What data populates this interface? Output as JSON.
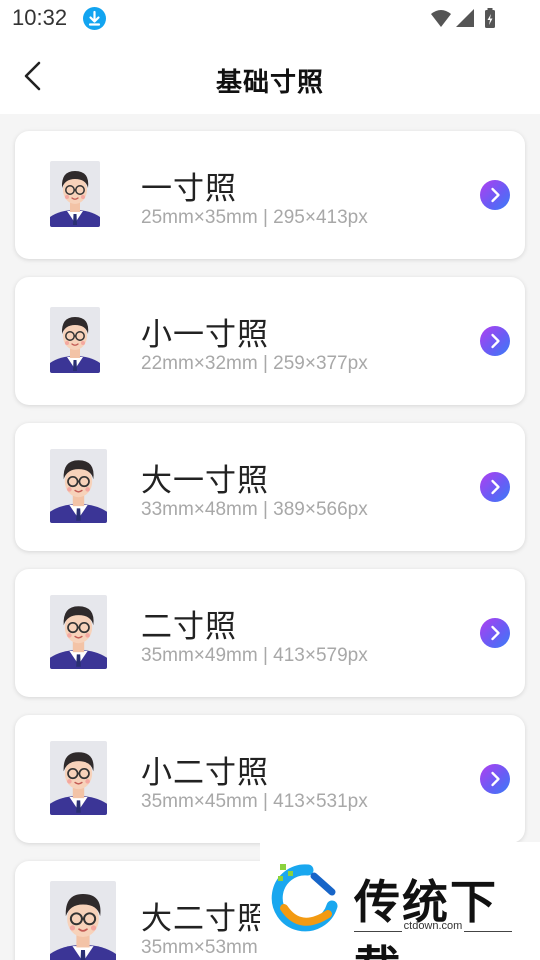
{
  "status_bar": {
    "time": "10:32"
  },
  "header": {
    "title": "基础寸照"
  },
  "items": [
    {
      "name": "一寸照",
      "spec": "25mm×35mm | 295×413px"
    },
    {
      "name": "小一寸照",
      "spec": "22mm×32mm | 259×377px"
    },
    {
      "name": "大一寸照",
      "spec": "33mm×48mm | 389×566px"
    },
    {
      "name": "二寸照",
      "spec": "35mm×49mm | 413×579px"
    },
    {
      "name": "小二寸照",
      "spec": "35mm×45mm | 413×531px"
    },
    {
      "name": "大二寸照",
      "spec": "35mm×53mm"
    }
  ],
  "watermark": {
    "text": "传统下载",
    "url": "ctdown.com"
  },
  "colors": {
    "accent_start": "#b13ff0",
    "accent_end": "#3a7cf6",
    "download_badge": "#12a4f0"
  },
  "icons": {
    "back": "chevron-left-icon",
    "item_arrow": "chevron-right-icon",
    "download": "download-icon"
  }
}
